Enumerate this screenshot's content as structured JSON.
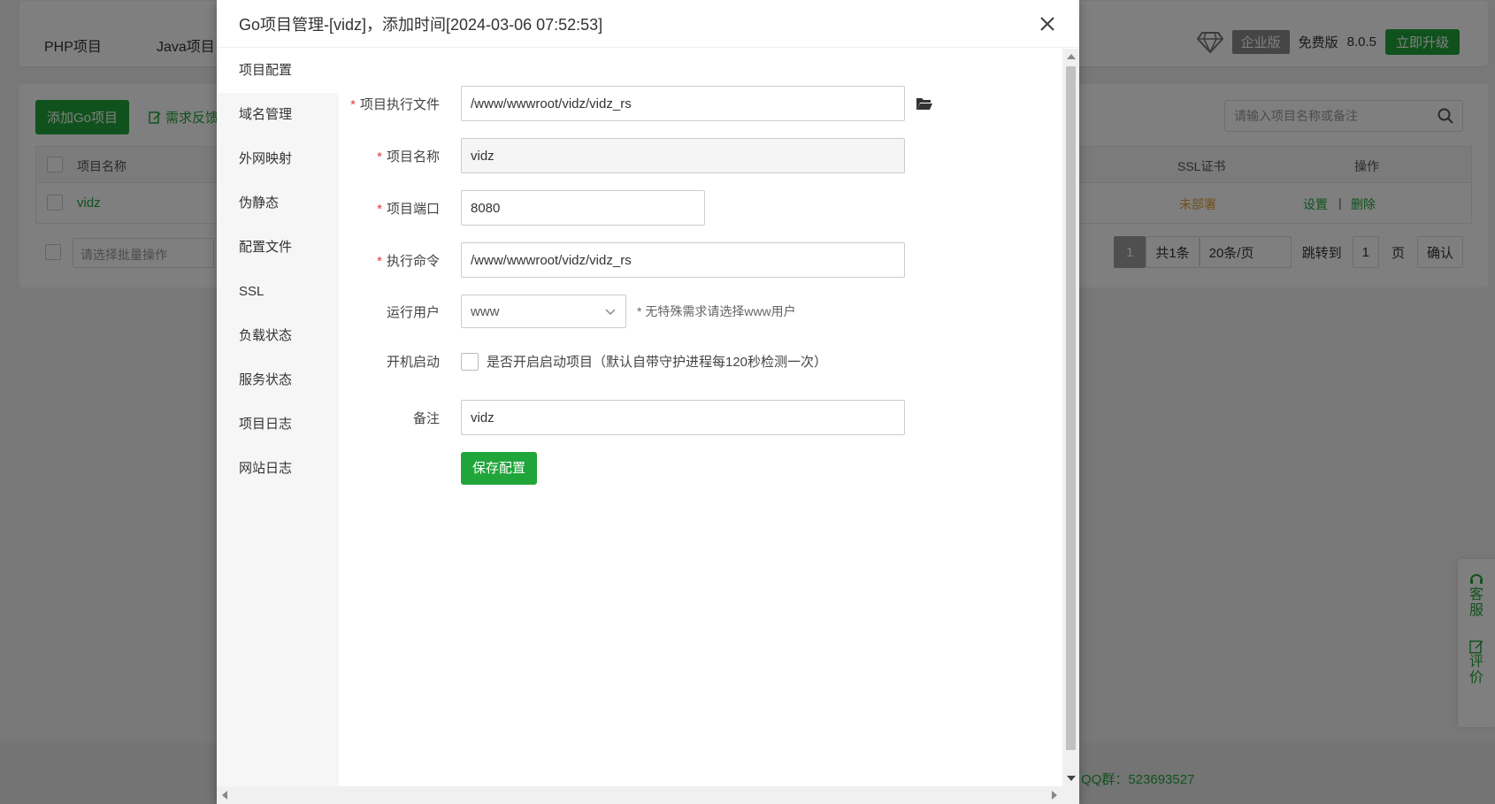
{
  "bg": {
    "tabs": [
      "PHP项目",
      "Java项目"
    ],
    "edition_badge": "企业版",
    "free_label": "免费版",
    "version": "8.0.5",
    "upgrade_label": "立即升级",
    "add_button": "添加Go项目",
    "feedback_label": "需求反馈",
    "search_placeholder": "请输入项目名称或备注",
    "columns": {
      "name": "项目名称",
      "ssl": "SSL证书",
      "ops": "操作"
    },
    "row": {
      "name": "vidz",
      "ssl": "未部署",
      "settings": "设置",
      "sep": "|",
      "delete": "删除"
    },
    "batch_placeholder": "请选择批量操作",
    "pager": {
      "current": "1",
      "total": "共1条",
      "per_page": "20条/页",
      "jump_label": "跳转到",
      "jump_value": "1",
      "page_unit": "页",
      "confirm": "确认"
    },
    "footer_qq": "QQ群：523693527",
    "float": {
      "service": "客服",
      "review": "评价"
    }
  },
  "modal": {
    "title": "Go项目管理-[vidz]，添加时间[2024-03-06 07:52:53]",
    "nav": [
      "项目配置",
      "域名管理",
      "外网映射",
      "伪静态",
      "配置文件",
      "SSL",
      "负载状态",
      "服务状态",
      "项目日志",
      "网站日志"
    ],
    "form": {
      "exec_file_label": "项目执行文件",
      "exec_file_value": "/www/wwwroot/vidz/vidz_rs",
      "name_label": "项目名称",
      "name_value": "vidz",
      "port_label": "项目端口",
      "port_value": "8080",
      "cmd_label": "执行命令",
      "cmd_value": "/www/wwwroot/vidz/vidz_rs",
      "user_label": "运行用户",
      "user_value": "www",
      "user_hint": "* 无特殊需求请选择www用户",
      "boot_label": "开机启动",
      "boot_text": "是否开启启动项目（默认自带守护进程每120秒检测一次）",
      "boot_checked": false,
      "remark_label": "备注",
      "remark_value": "vidz",
      "required_mark": "*",
      "save_label": "保存配置"
    }
  },
  "colors": {
    "accent": "#20a53a",
    "required": "#e53935",
    "warning": "#e6a23c"
  }
}
